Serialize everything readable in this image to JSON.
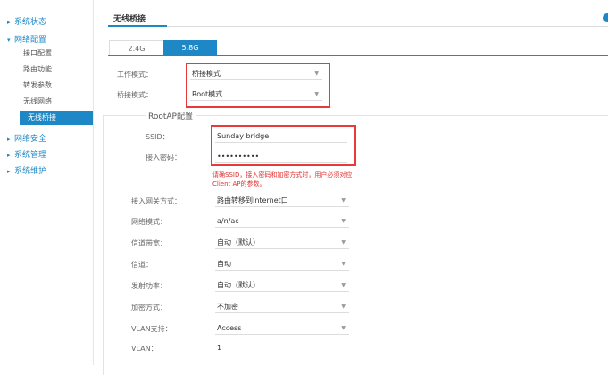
{
  "sidebar": {
    "groups": [
      {
        "label": "系统状态"
      },
      {
        "label": "网络配置"
      },
      {
        "label": "网络安全"
      },
      {
        "label": "系统管理"
      },
      {
        "label": "系统维护"
      }
    ],
    "network_items": [
      {
        "label": "接口配置"
      },
      {
        "label": "路由功能"
      },
      {
        "label": "转发参数"
      },
      {
        "label": "无线网络"
      },
      {
        "label": "无线桥接"
      }
    ],
    "expanded_arrow": "▾",
    "collapsed_arrow": "▸"
  },
  "main": {
    "title": "无线桥接",
    "tabs": [
      {
        "label": "2.4G"
      },
      {
        "label": "5.8G"
      }
    ],
    "work_mode": {
      "label": "工作模式：",
      "value": "桥接模式"
    },
    "bridge_mode": {
      "label": "桥接模式：",
      "value": "Root模式"
    },
    "section_title": "RootAP配置",
    "ssid": {
      "label": "SSID：",
      "value": "Sunday bridge"
    },
    "password": {
      "label": "接入密码：",
      "value": "••••••••••"
    },
    "warning": "请确SSID，接入密码和加密方式时，用户必须对应Client AP的参数。",
    "rows": [
      {
        "label": "接入网关方式：",
        "value": "路由转移到Internet口"
      },
      {
        "label": "网络模式：",
        "value": "a/n/ac"
      },
      {
        "label": "信道带宽：",
        "value": "自动（默认）"
      },
      {
        "label": "信道：",
        "value": "自动"
      },
      {
        "label": "发射功率：",
        "value": "自动（默认）"
      },
      {
        "label": "加密方式：",
        "value": "不加密"
      },
      {
        "label": "VLAN支持：",
        "value": "Access"
      },
      {
        "label": "VLAN：",
        "value": "1"
      }
    ]
  },
  "colors": {
    "accent": "#1e88c7",
    "highlight": "#e83a3a",
    "warning": "#e03030"
  }
}
